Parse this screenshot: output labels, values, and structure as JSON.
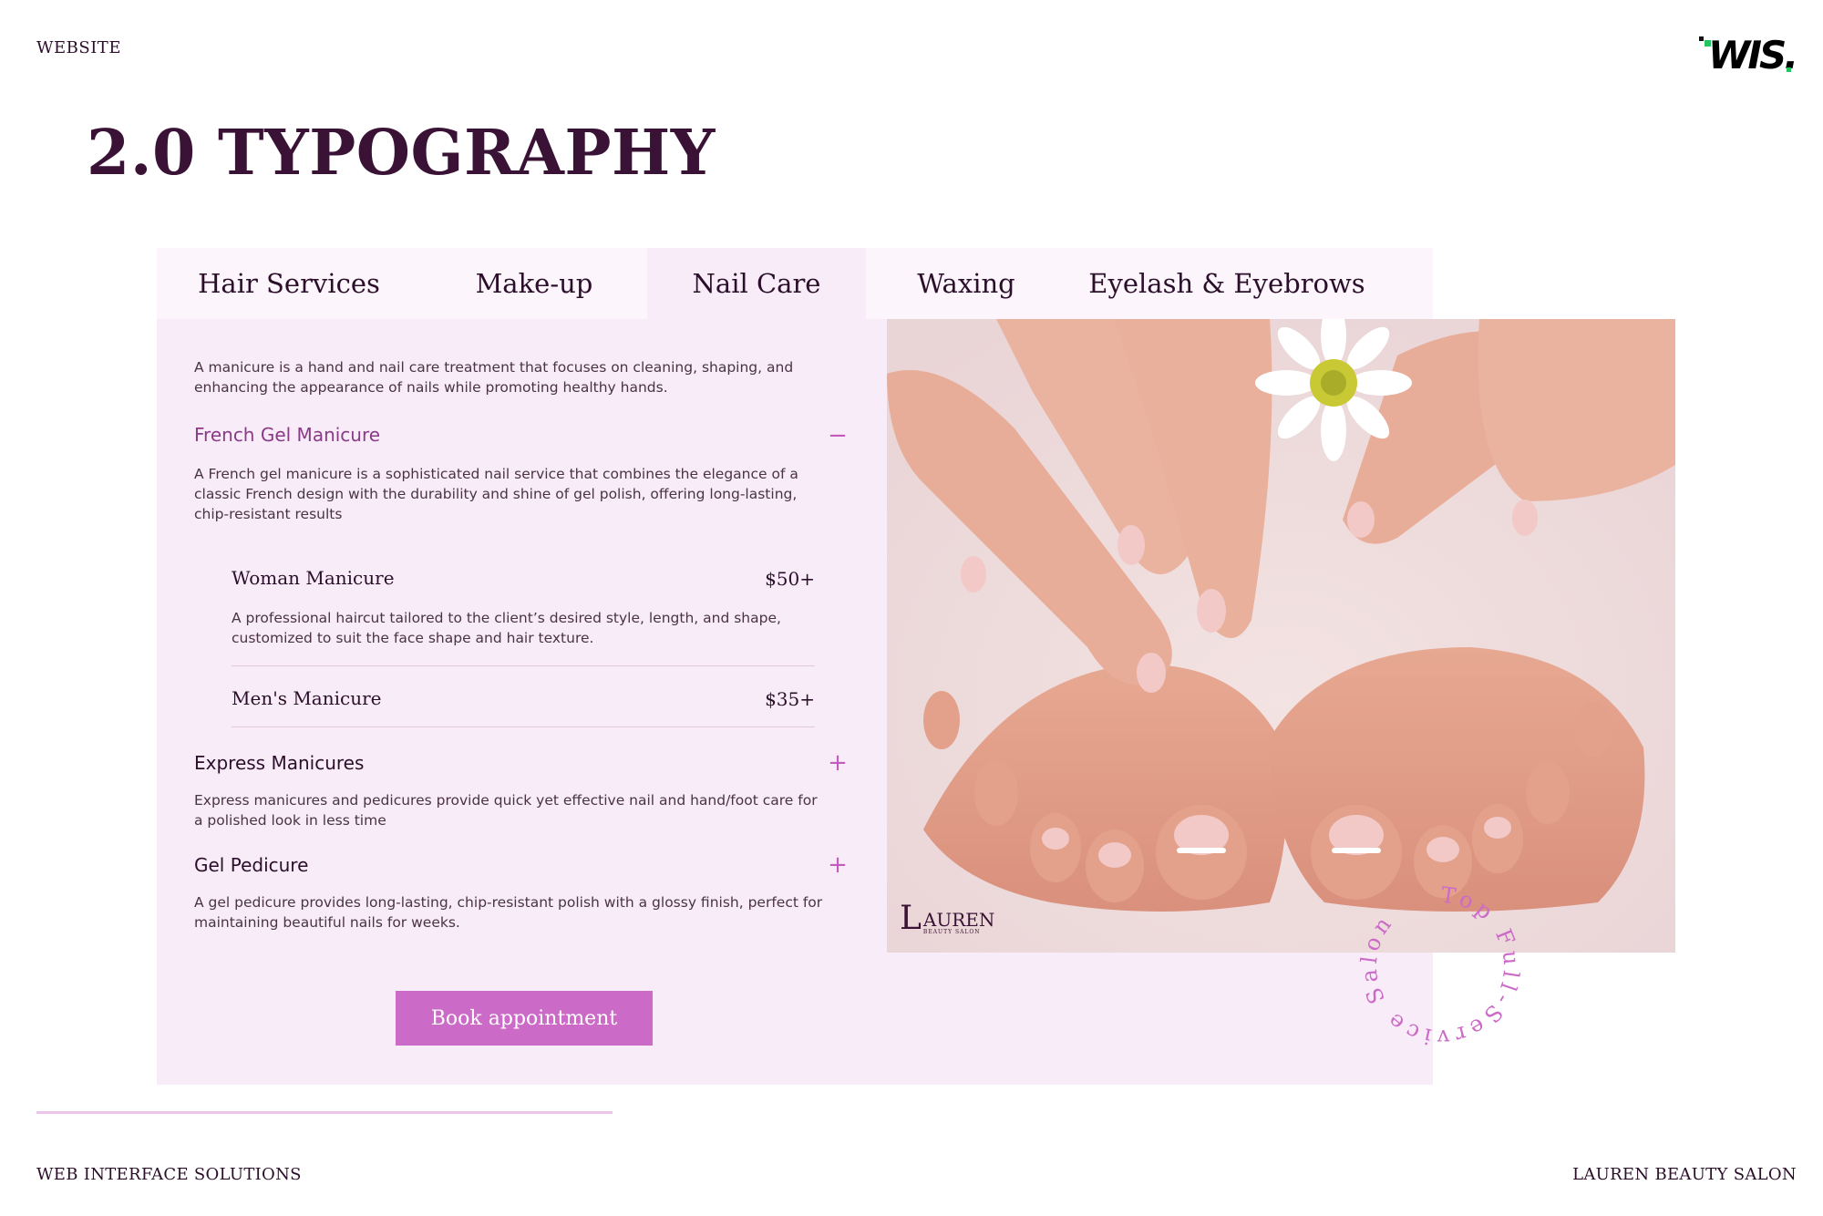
{
  "header": {
    "section_label": "WEBSITE",
    "logo_text": "WIS.",
    "page_title": "2.0 TYPOGRAPHY"
  },
  "tabs": [
    {
      "label": "Hair Services",
      "active": false
    },
    {
      "label": "Make-up",
      "active": false
    },
    {
      "label": "Nail Care",
      "active": true
    },
    {
      "label": "Waxing",
      "active": false
    },
    {
      "label": "Eyelash & Eyebrows",
      "active": false
    }
  ],
  "nail_care": {
    "intro": "A manicure is a hand and nail care treatment that focuses on cleaning, shaping, and enhancing the appearance of nails while promoting healthy hands.",
    "accordion": [
      {
        "title": "French Gel Manicure",
        "toggle": "−",
        "expanded": true,
        "description": "A French gel manicure is a sophisticated nail service that combines the elegance of a classic French design with the durability and shine of gel polish, offering long-lasting, chip-resistant results",
        "services": [
          {
            "name": "Woman Manicure",
            "price": "$50+",
            "description": "A professional haircut tailored to the client’s desired style, length, and shape, customized to suit the face shape and hair texture."
          },
          {
            "name": "Men's Manicure",
            "price": "$35+"
          }
        ]
      },
      {
        "title": "Express Manicures",
        "toggle": "+",
        "expanded": false,
        "description": "Express manicures and pedicures provide quick yet effective nail and hand/foot care for a polished look in less time"
      },
      {
        "title": "Gel Pedicure",
        "toggle": "+",
        "expanded": false,
        "description": "A gel pedicure provides long-lasting, chip-resistant polish with a glossy finish, perfect for maintaining beautiful nails for weeks."
      }
    ],
    "book_button": "Book appointment"
  },
  "photo": {
    "brand_name": "AUREN",
    "brand_initial": "L",
    "brand_sub": "BEAUTY SALON"
  },
  "badge": {
    "text": "Top Full-Service Salon "
  },
  "footer": {
    "left": "WEB INTERFACE SOLUTIONS",
    "right": "LAUREN BEAUTY SALON"
  },
  "colors": {
    "accent": "#cc6ac7",
    "title_dark": "#3a1235",
    "panel_bg": "#f8ecf8",
    "accordion_open": "#8a3a86"
  }
}
